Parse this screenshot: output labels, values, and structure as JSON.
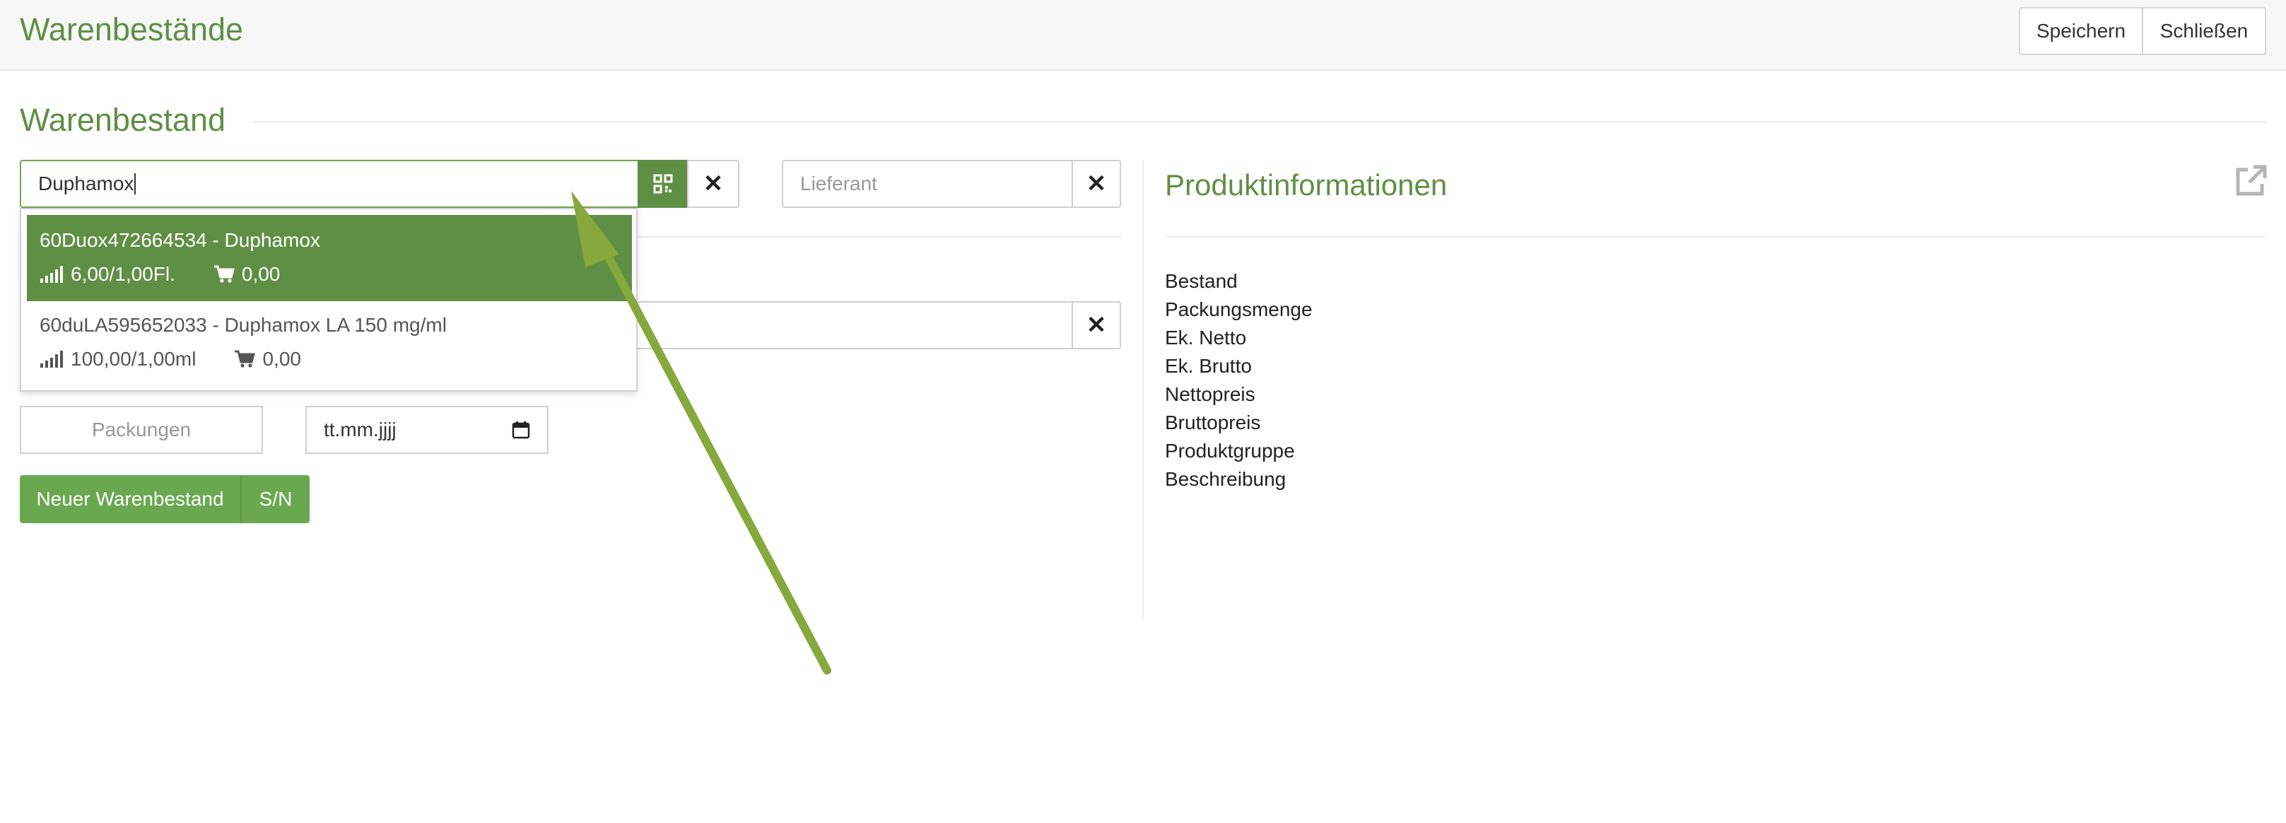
{
  "header": {
    "title": "Warenbestände",
    "save_label": "Speichern",
    "close_label": "Schließen"
  },
  "section": {
    "title": "Warenbestand"
  },
  "search": {
    "value": "Duphamox"
  },
  "supplier": {
    "placeholder": "Lieferant"
  },
  "dropdown": {
    "items": [
      {
        "title": "60Duox472664534 - Duphamox",
        "stock": "6,00/1,00Fl.",
        "cart": "0,00",
        "active": true
      },
      {
        "title": "60duLA595652033 - Duphamox LA 150 mg/ml",
        "stock": "100,00/1,00ml",
        "cart": "0,00",
        "active": false
      }
    ]
  },
  "packs": {
    "placeholder": "Packungen"
  },
  "date": {
    "placeholder": "tt.mm.jjjj"
  },
  "actions": {
    "new_label": "Neuer Warenbestand",
    "sn_label": "S/N"
  },
  "product_info": {
    "title": "Produktinformationen",
    "fields": [
      "Bestand",
      "Packungsmenge",
      "Ek. Netto",
      "Ek. Brutto",
      "Nettopreis",
      "Bruttopreis",
      "Produktgruppe",
      "Beschreibung"
    ]
  },
  "colors": {
    "accent": "#5f8f44",
    "button_green": "#6aa84f",
    "arrow": "#86a83c"
  }
}
